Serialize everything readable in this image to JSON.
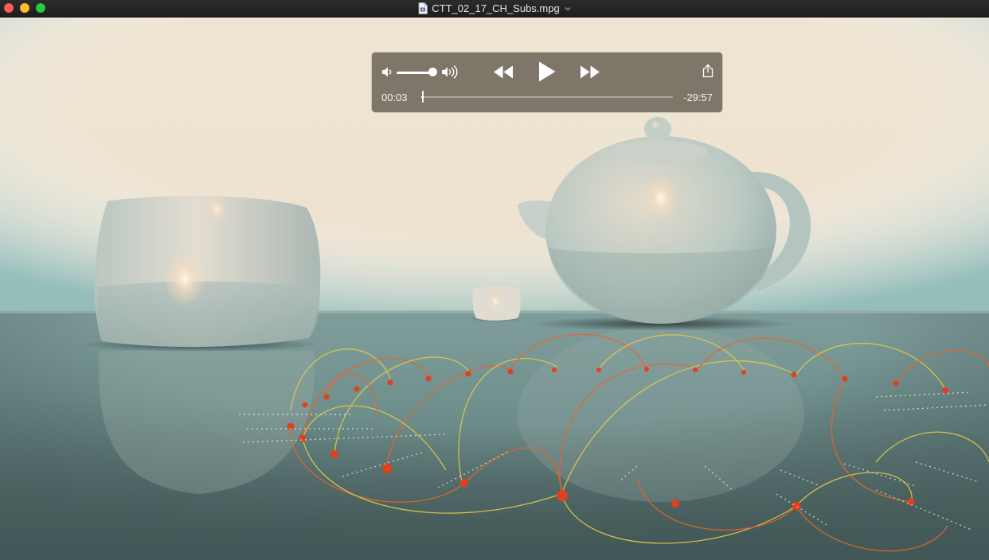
{
  "window": {
    "title": "CTT_02_17_CH_Subs.mpg",
    "icons": {
      "document": "document-icon",
      "title_menu": "chevron-down-icon"
    }
  },
  "player": {
    "time_elapsed": "00:03",
    "time_remaining": "-29:57",
    "playback_progress": 0.0017,
    "volume_level": 0.85,
    "state": "paused",
    "icons": {
      "volume_low": "volume-low-icon",
      "volume_high": "volume-high-icon",
      "rewind": "rewind-icon",
      "play": "play-icon",
      "fast_forward": "fast-forward-icon",
      "share": "share-icon"
    }
  },
  "colors": {
    "hud_background": "#70675b",
    "close": "#fc5f57",
    "minimize": "#fdbc2e",
    "maximize": "#28c840",
    "arc_orange": "#e8652c",
    "arc_yellow": "#e2c948",
    "node_red": "#e0401c"
  }
}
